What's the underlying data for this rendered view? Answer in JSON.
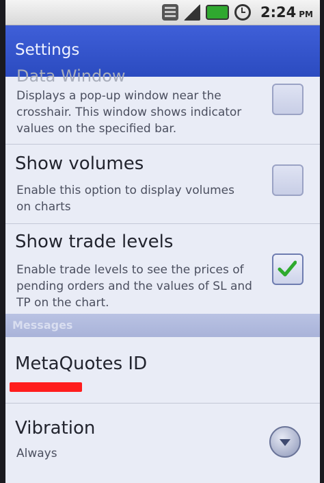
{
  "status_bar": {
    "time": "2:24",
    "ampm": "PM"
  },
  "title_bar": {
    "title": "Settings"
  },
  "data_window": {
    "title": "Data Window",
    "summary": "Displays a pop-up window near the crosshair. This window shows indicator values on the specified bar.",
    "checked": false
  },
  "show_volumes": {
    "title": "Show volumes",
    "summary": "Enable this option to display volumes on charts",
    "checked": false
  },
  "show_trade_levels": {
    "title": "Show trade levels",
    "summary": "Enable trade levels to see the prices of pending orders and the values of SL and TP on the chart.",
    "checked": true
  },
  "messages_section": {
    "label": "Messages"
  },
  "metaquotes_id": {
    "title": "MetaQuotes ID"
  },
  "vibration": {
    "title": "Vibration",
    "summary": "Always"
  },
  "colors": {
    "accent": "#2b4bc0",
    "check": "#2eaa2e",
    "highlight": "#ff1d1d"
  }
}
